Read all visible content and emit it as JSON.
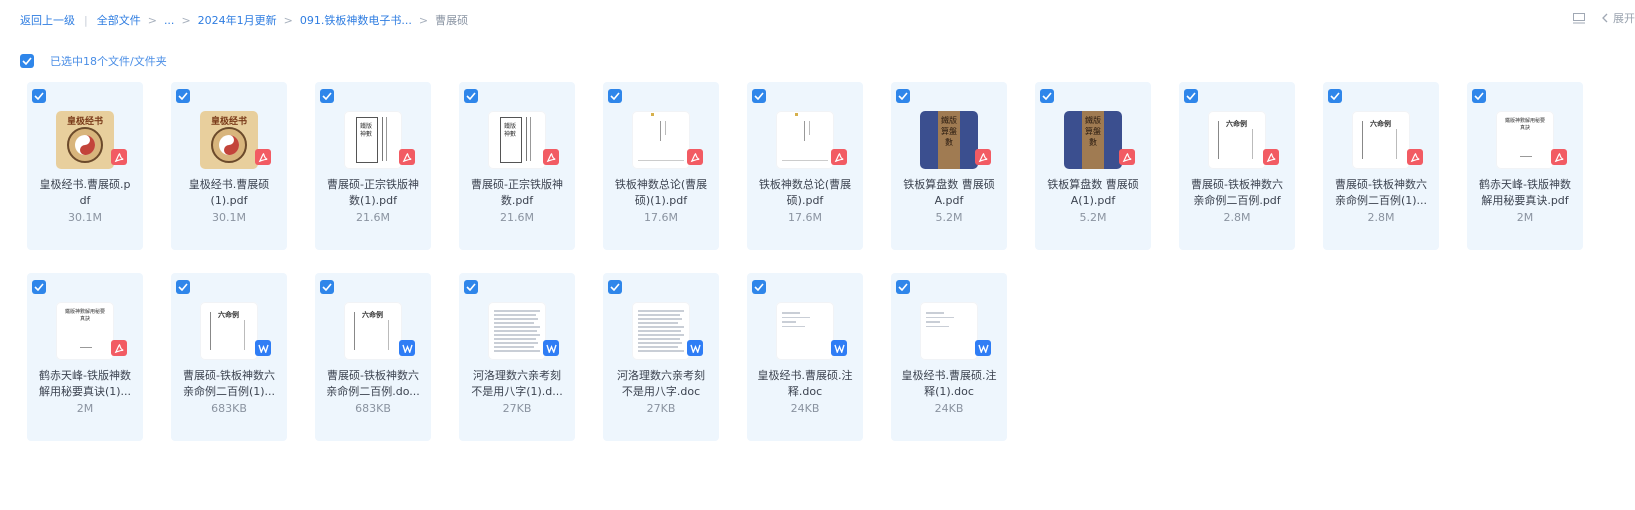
{
  "breadcrumb": {
    "back": "返回上一级",
    "all_files": "全部文件",
    "ellipsis": "...",
    "folder1": "2024年1月更新",
    "folder2": "091.铁板神数电子书...",
    "current": "曹展硕"
  },
  "toolbar": {
    "expand_label": "展开",
    "icons": [
      "layout-icon",
      "chevron-left-icon"
    ]
  },
  "selection": {
    "text": "已选中18个文件/文件夹"
  },
  "colors": {
    "accent": "#2f86ea",
    "tile_bg": "#eef6fd",
    "pdf_badge": "#f25b63",
    "doc_badge": "#2f7df5"
  },
  "files": [
    {
      "name": "皇极经书.曹展硕.pdf",
      "size": "30.1M",
      "type": "pdf",
      "thumb": "huangji"
    },
    {
      "name": "皇极经书.曹展硕(1).pdf",
      "size": "30.1M",
      "type": "pdf",
      "thumb": "huangji"
    },
    {
      "name": "曹展硕-正宗铁版神数(1).pdf",
      "size": "21.6M",
      "type": "pdf",
      "thumb": "scroll"
    },
    {
      "name": "曹展硕-正宗铁版神数.pdf",
      "size": "21.6M",
      "type": "pdf",
      "thumb": "scroll"
    },
    {
      "name": "铁板神数总论(曹展硕)(1).pdf",
      "size": "17.6M",
      "type": "pdf",
      "thumb": "plain"
    },
    {
      "name": "铁板神数总论(曹展硕).pdf",
      "size": "17.6M",
      "type": "pdf",
      "thumb": "plain"
    },
    {
      "name": "铁板算盘数 曹展硕A.pdf",
      "size": "5.2M",
      "type": "pdf",
      "thumb": "bluebook"
    },
    {
      "name": "铁板算盘数 曹展硕A(1).pdf",
      "size": "5.2M",
      "type": "pdf",
      "thumb": "bluebook"
    },
    {
      "name": "曹展硕-铁板神数六亲命例二百例.pdf",
      "size": "2.8M",
      "type": "pdf",
      "thumb": "text"
    },
    {
      "name": "曹展硕-铁板神数六亲命例二百例(1).pdf",
      "size": "2.8M",
      "type": "pdf",
      "thumb": "text"
    },
    {
      "name": "鹤赤天峰-铁版神数解用秘要真诀.pdf",
      "size": "2M",
      "type": "pdf",
      "thumb": "cover"
    },
    {
      "name": "鹤赤天峰-铁版神数解用秘要真诀(1).pdf",
      "size": "2M",
      "type": "pdf",
      "thumb": "cover"
    },
    {
      "name": "曹展硕-铁板神数六亲命例二百例(1).doc",
      "size": "683KB",
      "type": "doc",
      "thumb": "text"
    },
    {
      "name": "曹展硕-铁板神数六亲命例二百例.doc",
      "size": "683KB",
      "type": "doc",
      "thumb": "text"
    },
    {
      "name": "河洛理数六亲考刻不是用八字(1).doc",
      "size": "27KB",
      "type": "doc",
      "thumb": "dense"
    },
    {
      "name": "河洛理数六亲考刻不是用八字.doc",
      "size": "27KB",
      "type": "doc",
      "thumb": "dense"
    },
    {
      "name": "皇极经书.曹展硕.注释.doc",
      "size": "24KB",
      "type": "doc",
      "thumb": "sparse"
    },
    {
      "name": "皇极经书.曹展硕.注释(1).doc",
      "size": "24KB",
      "type": "doc",
      "thumb": "sparse"
    }
  ],
  "file_labels": [
    {
      "line1": "皇极经书.曹展硕.p",
      "line2": "df"
    },
    {
      "line1": "皇极经书.曹展硕",
      "line2": "(1).pdf"
    },
    {
      "line1": "曹展硕-正宗铁版神",
      "line2": "数(1).pdf"
    },
    {
      "line1": "曹展硕-正宗铁版神",
      "line2": "数.pdf"
    },
    {
      "line1": "铁板神数总论(曹展",
      "line2": "硕)(1).pdf"
    },
    {
      "line1": "铁板神数总论(曹展",
      "line2": "硕).pdf"
    },
    {
      "line1": "铁板算盘数 曹展硕",
      "line2": "A.pdf"
    },
    {
      "line1": "铁板算盘数 曹展硕",
      "line2": "A(1).pdf"
    },
    {
      "line1": "曹展硕-铁板神数六",
      "line2": "亲命例二百例.pdf"
    },
    {
      "line1": "曹展硕-铁板神数六",
      "line2": "亲命例二百例(1)..."
    },
    {
      "line1": "鹤赤天峰-铁版神数",
      "line2": "解用秘要真诀.pdf"
    },
    {
      "line1": "鹤赤天峰-铁版神数",
      "line2": "解用秘要真诀(1)..."
    },
    {
      "line1": "曹展硕-铁板神数六",
      "line2": "亲命例二百例(1)..."
    },
    {
      "line1": "曹展硕-铁板神数六",
      "line2": "亲命例二百例.do..."
    },
    {
      "line1": "河洛理数六亲考刻",
      "line2": "不是用八字(1).d..."
    },
    {
      "line1": "河洛理数六亲考刻",
      "line2": "不是用八字.doc"
    },
    {
      "line1": "皇极经书.曹展硕.注",
      "line2": "释.doc"
    },
    {
      "line1": "皇极经书.曹展硕.注",
      "line2": "释(1).doc"
    }
  ]
}
